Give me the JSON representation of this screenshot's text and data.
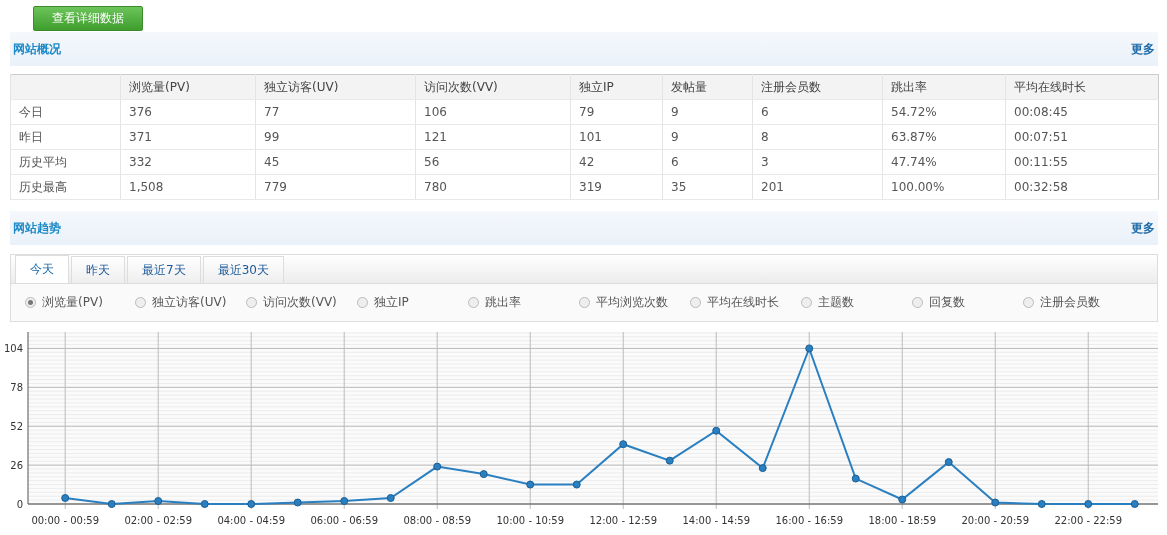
{
  "detail_button": "查看详细数据",
  "overview": {
    "title": "网站概况",
    "more": "更多",
    "columns": [
      "",
      "浏览量(PV)",
      "独立访客(UV)",
      "访问次数(VV)",
      "独立IP",
      "发帖量",
      "注册会员数",
      "跳出率",
      "平均在线时长"
    ],
    "rows": [
      [
        "今日",
        "376",
        "77",
        "106",
        "79",
        "9",
        "6",
        "54.72%",
        "00:08:45"
      ],
      [
        "昨日",
        "371",
        "99",
        "121",
        "101",
        "9",
        "8",
        "63.87%",
        "00:07:51"
      ],
      [
        "历史平均",
        "332",
        "45",
        "56",
        "42",
        "6",
        "3",
        "47.74%",
        "00:11:55"
      ],
      [
        "历史最高",
        "1,508",
        "779",
        "780",
        "319",
        "35",
        "201",
        "100.00%",
        "00:32:58"
      ]
    ]
  },
  "trend": {
    "title": "网站趋势",
    "more": "更多",
    "tabs": [
      {
        "label": "今天",
        "selected": true
      },
      {
        "label": "昨天",
        "selected": false
      },
      {
        "label": "最近7天",
        "selected": false
      },
      {
        "label": "最近30天",
        "selected": false
      }
    ],
    "metrics": [
      {
        "label": "浏览量(PV)",
        "selected": true
      },
      {
        "label": "独立访客(UV)",
        "selected": false
      },
      {
        "label": "访问次数(VV)",
        "selected": false
      },
      {
        "label": "独立IP",
        "selected": false
      },
      {
        "label": "跳出率",
        "selected": false
      },
      {
        "label": "平均浏览次数",
        "selected": false
      },
      {
        "label": "平均在线时长",
        "selected": false
      },
      {
        "label": "主题数",
        "selected": false
      },
      {
        "label": "回复数",
        "selected": false
      },
      {
        "label": "注册会员数",
        "selected": false
      }
    ],
    "chart_data": {
      "type": "line",
      "categories": [
        "00:00 - 00:59",
        null,
        "02:00 - 02:59",
        null,
        "04:00 - 04:59",
        null,
        "06:00 - 06:59",
        null,
        "08:00 - 08:59",
        null,
        "10:00 - 10:59",
        null,
        "12:00 - 12:59",
        null,
        "14:00 - 14:59",
        null,
        "16:00 - 16:59",
        null,
        "18:00 - 18:59",
        null,
        "20:00 - 20:59",
        null,
        "22:00 - 22:59",
        null
      ],
      "grid": true,
      "series": [
        {
          "color": "#2a7fc0",
          "marker": true,
          "values": [
            4,
            0,
            2,
            0,
            0,
            1,
            2,
            4,
            25,
            20,
            13,
            13,
            40,
            29,
            49,
            24,
            104,
            17,
            3,
            28,
            1,
            0,
            0,
            0
          ]
        }
      ],
      "ylim": [
        0,
        115
      ],
      "yticks": [
        0,
        26,
        52,
        78,
        104
      ]
    }
  }
}
